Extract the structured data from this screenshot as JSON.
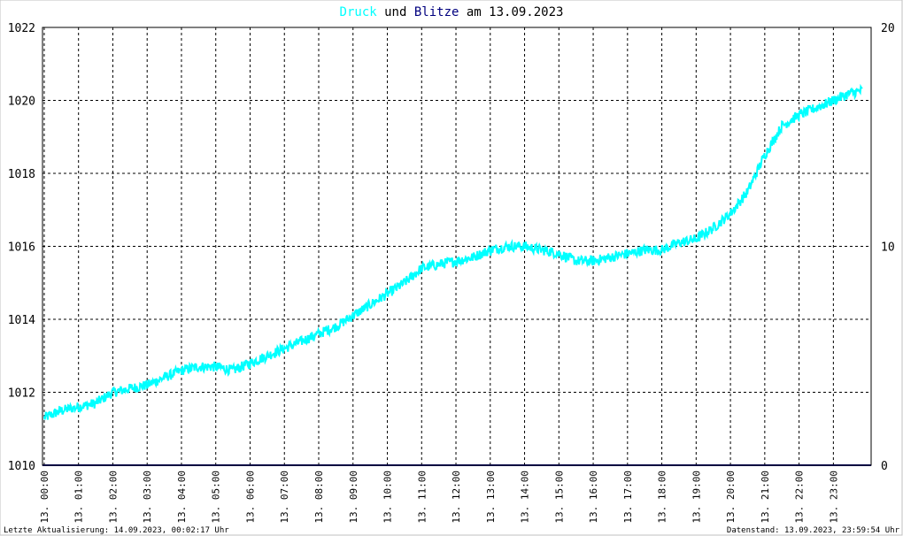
{
  "title": {
    "series1": "Druck",
    "sep": " und ",
    "series2": "Blitze",
    "suffix": " am 13.09.2023"
  },
  "footer": {
    "left": "Letzte Aktualisierung: 14.09.2023, 00:02:17 Uhr",
    "right": "Datenstand: 13.09.2023, 23:59:54 Uhr"
  },
  "colors": {
    "druck": "#00ffff",
    "blitze": "#00007f",
    "title_default": "#000000",
    "grid": "#000000",
    "background": "#ffffff",
    "border": "#000000"
  },
  "chart_data": {
    "type": "line",
    "title": "Druck und Blitze am 13.09.2023",
    "y_left": {
      "ylim": [
        1010,
        1022
      ],
      "ticks": [
        "1010",
        "1012",
        "1014",
        "1016",
        "1018",
        "1020",
        "1022"
      ]
    },
    "y_right": {
      "ylim": [
        0,
        20
      ],
      "ticks": [
        "0",
        "10",
        "20"
      ]
    },
    "x_ticks": [
      "13. 00:00",
      "13. 01:00",
      "13. 02:00",
      "13. 03:00",
      "13. 04:00",
      "13. 05:00",
      "13. 06:00",
      "13. 07:00",
      "13. 08:00",
      "13. 09:00",
      "13. 10:00",
      "13. 11:00",
      "13. 12:00",
      "13. 13:00",
      "13. 14:00",
      "13. 15:00",
      "13. 16:00",
      "13. 17:00",
      "13. 18:00",
      "13. 19:00",
      "13. 20:00",
      "13. 21:00",
      "13. 22:00",
      "13. 23:00"
    ],
    "grid": true,
    "series": [
      {
        "name": "Druck",
        "axis": "left",
        "x_hours": [
          0,
          0.5,
          1,
          1.5,
          2,
          2.5,
          3,
          3.5,
          4,
          4.5,
          5,
          5.5,
          6,
          6.5,
          7,
          7.5,
          8,
          8.5,
          9,
          9.5,
          10,
          10.5,
          11,
          11.5,
          12,
          12.5,
          13,
          13.5,
          14,
          14.5,
          15,
          15.5,
          16,
          16.5,
          17,
          17.5,
          18,
          18.5,
          19,
          19.5,
          20,
          20.5,
          21,
          21.5,
          22,
          22.5,
          23,
          23.5,
          24
        ],
        "values": [
          1011.3,
          1011.5,
          1011.6,
          1011.7,
          1012.0,
          1012.1,
          1012.2,
          1012.4,
          1012.6,
          1012.7,
          1012.7,
          1012.6,
          1012.8,
          1013.0,
          1013.2,
          1013.4,
          1013.6,
          1013.8,
          1014.1,
          1014.4,
          1014.7,
          1015.0,
          1015.4,
          1015.5,
          1015.6,
          1015.7,
          1015.9,
          1016.0,
          1016.0,
          1015.9,
          1015.8,
          1015.6,
          1015.6,
          1015.7,
          1015.8,
          1015.9,
          1015.9,
          1016.1,
          1016.2,
          1016.5,
          1016.9,
          1017.5,
          1018.5,
          1019.3,
          1019.6,
          1019.8,
          1020.0,
          1020.2,
          1020.3
        ]
      },
      {
        "name": "Blitze",
        "axis": "right",
        "x_hours": [
          0,
          24
        ],
        "values": [
          0,
          0
        ]
      }
    ]
  }
}
